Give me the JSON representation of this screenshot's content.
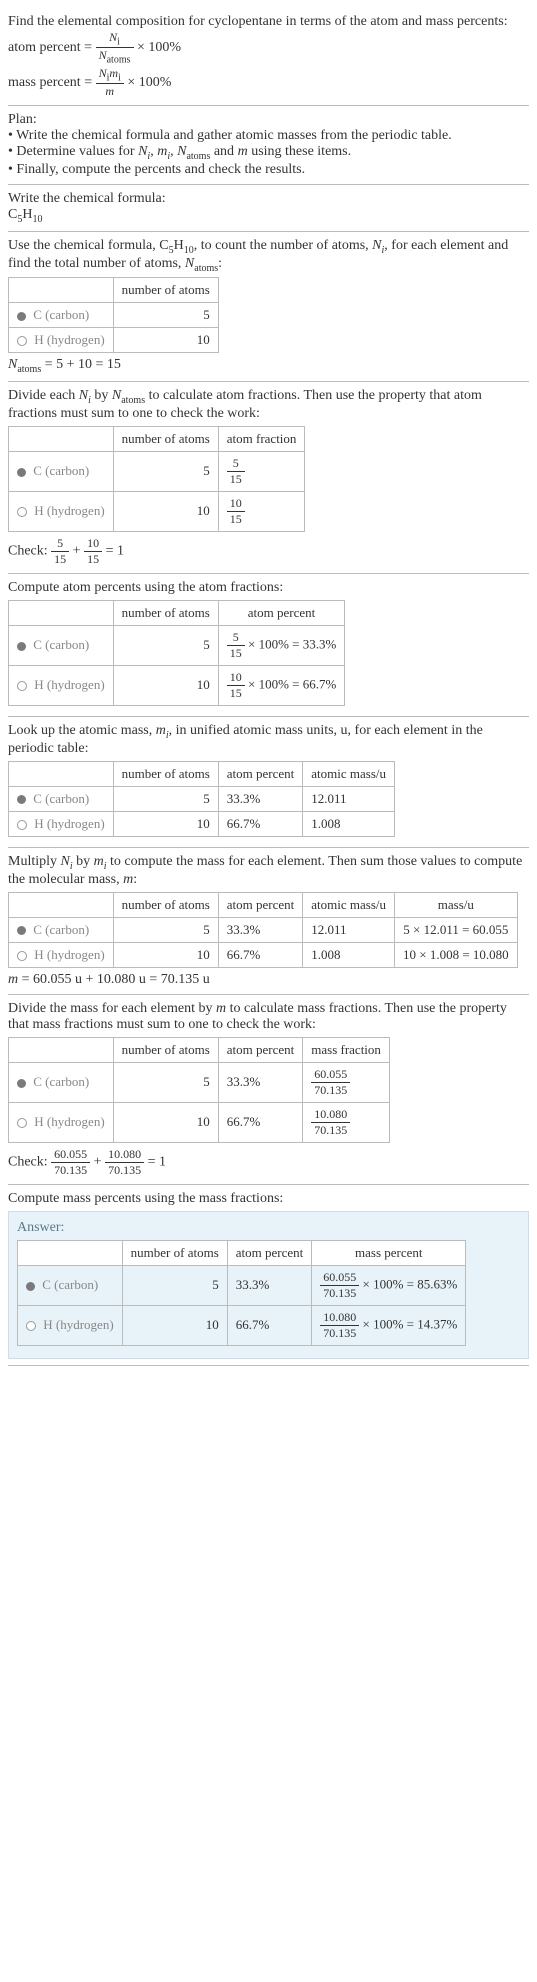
{
  "intro": {
    "line1": "Find the elemental composition for cyclopentane in terms of the atom and mass percents:",
    "ap_label": "atom percent = ",
    "ap_num": "N",
    "ap_num_sub": "i",
    "ap_den": "N",
    "ap_den_sub": "atoms",
    "pct": " × 100%",
    "mp_label": "mass percent = ",
    "mp_num_l": "N",
    "mp_num_s1": "i",
    "mp_num_m": "m",
    "mp_num_s2": "i",
    "mp_den": "m"
  },
  "plan": {
    "head": "Plan:",
    "b1": "• Write the chemical formula and gather atomic masses from the periodic table.",
    "b2_a": "• Determine values for ",
    "b2_ni": "N",
    "b2_i": "i",
    "b2_c1": ", ",
    "b2_mi": "m",
    "b2_c2": ", ",
    "b2_na": "N",
    "b2_as": "atoms",
    "b2_c3": " and ",
    "b2_m": "m",
    "b2_e": " using these items.",
    "b3": "• Finally, compute the percents and check the results."
  },
  "formula": {
    "head": "Write the chemical formula:",
    "c": "C",
    "c5": "5",
    "h": "H",
    "h10": "10"
  },
  "count": {
    "t1": "Use the chemical formula, C",
    "t2": "H",
    "t3": ", to count the number of atoms, ",
    "t4": ", for each element and find the total number of atoms, ",
    "t5": ":",
    "col_n": "number of atoms",
    "c_lbl": " C (carbon)",
    "h_lbl": " H (hydrogen)",
    "c_n": "5",
    "h_n": "10",
    "eq": " = 5 + 10 = 15"
  },
  "af": {
    "intro_a": "Divide each ",
    "intro_b": " by ",
    "intro_c": " to calculate atom fractions. Then use the property that atom fractions must sum to one to check the work:",
    "col_af": "atom fraction",
    "c_num": "5",
    "c_den": "15",
    "h_num": "10",
    "h_den": "15",
    "check_a": "Check: ",
    "check_b": " + ",
    "check_c": " = 1"
  },
  "ap": {
    "intro": "Compute atom percents using the atom fractions:",
    "col_ap": "atom percent",
    "c_val": " × 100% = 33.3%",
    "h_val": " × 100% = 66.7%",
    "c_pct": "33.3%",
    "h_pct": "66.7%"
  },
  "am": {
    "intro_a": "Look up the atomic mass, ",
    "intro_b": ", in unified atomic mass units, u, for each element in the periodic table:",
    "col_am": "atomic mass/u",
    "c_m": "12.011",
    "h_m": "1.008"
  },
  "mass": {
    "intro_a": "Multiply ",
    "intro_b": " by ",
    "intro_c": " to compute the mass for each element. Then sum those values to compute the molecular mass, ",
    "intro_d": ":",
    "col_mu": "mass/u",
    "c_mu": "5 × 12.011 = 60.055",
    "h_mu": "10 × 1.008 = 10.080",
    "eq": " = 60.055 u + 10.080 u = 70.135 u"
  },
  "mf": {
    "intro_a": "Divide the mass for each element by ",
    "intro_b": " to calculate mass fractions. Then use the property that mass fractions must sum to one to check the work:",
    "col_mf": "mass fraction",
    "c_num": "60.055",
    "c_den": "70.135",
    "h_num": "10.080",
    "h_den": "70.135",
    "check": "Check: ",
    "plus": " + ",
    "eq1": " = 1"
  },
  "mp": {
    "intro": "Compute mass percents using the mass fractions:",
    "ans": "Answer:",
    "col_mp": "mass percent",
    "c_val": " × 100% = 85.63%",
    "h_val": " × 100% = 14.37%"
  }
}
